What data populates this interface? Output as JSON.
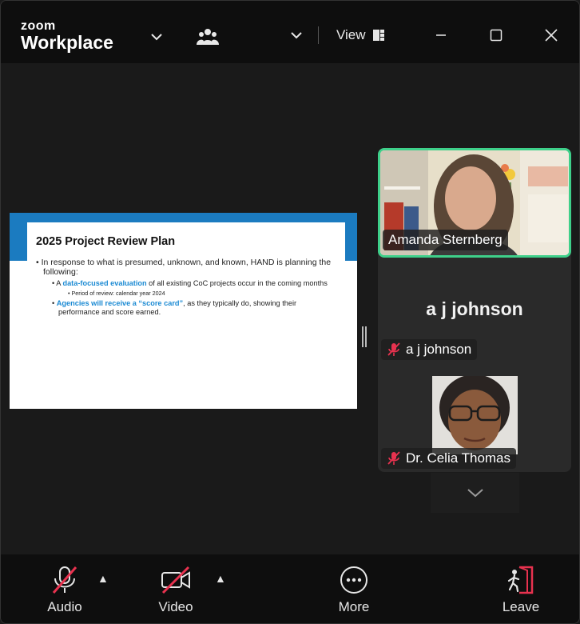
{
  "app": {
    "brand_top": "zoom",
    "brand_bottom": "Workplace"
  },
  "titlebar": {
    "view_label": "View"
  },
  "slide": {
    "title": "2025 Project Review Plan",
    "bullet1": "In response to what is presumed, unknown, and known, HAND is planning the following:",
    "bullet2_prefix": "A ",
    "bullet2_highlight": "data-focused evaluation",
    "bullet2_suffix": " of all existing CoC projects occur in the coming months",
    "bullet3": "Period of review: calendar year 2024",
    "bullet4_highlight": "Agencies will receive a “score card”",
    "bullet4_suffix": ", as they typically do, showing their performance and score earned."
  },
  "participants": {
    "active_speaker": "Amanda Sternberg",
    "aj_display_name": "a j johnson",
    "aj_label": "a j johnson",
    "celia_label": "Dr. Celia Thomas"
  },
  "toolbar": {
    "audio_label": "Audio",
    "video_label": "Video",
    "more_label": "More",
    "leave_label": "Leave"
  },
  "colors": {
    "active_speaker_border": "#3ed08a",
    "muted_icon": "#e8324f",
    "slide_accent": "#1b7bc0",
    "leave_icon": "#e8324f"
  },
  "icons": [
    "people-icon",
    "view-layout-icon",
    "minimize-icon",
    "maximize-icon",
    "close-icon",
    "mic-muted-icon",
    "video-off-icon",
    "more-icon",
    "leave-icon",
    "chevron-down-icon"
  ]
}
